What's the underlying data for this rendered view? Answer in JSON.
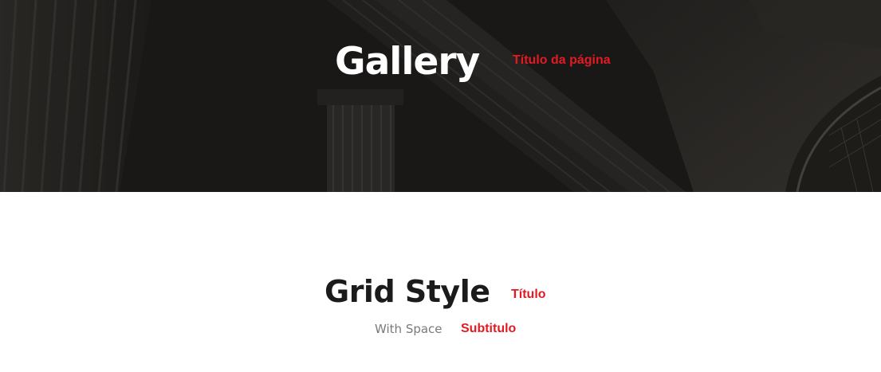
{
  "hero": {
    "title": "Gallery",
    "annotation": "Título da página"
  },
  "section": {
    "title": "Grid Style",
    "title_annotation": "Título",
    "subtitle": "With Space",
    "subtitle_annotation": "Subtitulo"
  },
  "colors": {
    "hero_overlay": "#1f1e1d",
    "annotation": "#e21b23",
    "heading": "#1b1b1b",
    "subtitle": "#7a7a7a"
  }
}
